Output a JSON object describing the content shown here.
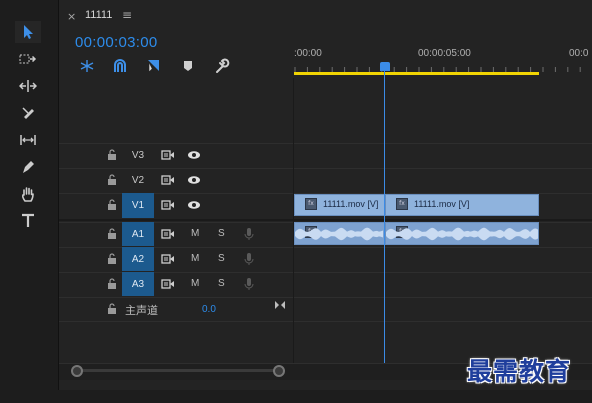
{
  "tab": {
    "close": "×",
    "title": "11111",
    "menu": "≡"
  },
  "timecode": "00:00:03:00",
  "ruler": {
    "labels": [
      ":00:00",
      "00:00:05:00",
      "00:0"
    ],
    "playhead_time": "00:00:03:00"
  },
  "header_tools": [
    "snap-icon",
    "linked-selection-icon",
    "add-marker-icon",
    "marker-icon",
    "wrench-icon"
  ],
  "toolbar": [
    "selection-tool-icon",
    "track-select-tool-icon",
    "ripple-edit-tool-icon",
    "razor-tool-icon",
    "slip-tool-icon",
    "pen-tool-icon",
    "hand-tool-icon",
    "type-tool-icon"
  ],
  "video_tracks": [
    {
      "name": "V3",
      "targeted": false
    },
    {
      "name": "V2",
      "targeted": false
    },
    {
      "name": "V1",
      "targeted": true
    }
  ],
  "audio_tracks": [
    {
      "name": "A1",
      "targeted": true,
      "mute": "M",
      "solo": "S"
    },
    {
      "name": "A2",
      "targeted": true,
      "mute": "M",
      "solo": "S"
    },
    {
      "name": "A3",
      "targeted": true,
      "mute": "M",
      "solo": "S"
    }
  ],
  "master": {
    "label": "主声道",
    "value": "0.0"
  },
  "clips": {
    "video": [
      "11111.mov [V]",
      "11111.mov [V]"
    ],
    "fx_badge": "fx"
  },
  "watermark": "最需教育",
  "colors": {
    "accent": "#2d8ceb",
    "workarea": "#f1d403",
    "clip": "#8fb3dd",
    "track_target": "#1c5a8e"
  }
}
